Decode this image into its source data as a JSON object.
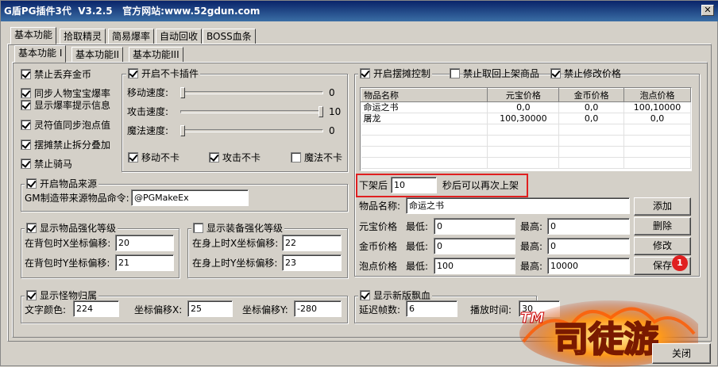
{
  "window": {
    "title": "G盾PG插件3代  V3.2.5   官方网站:www.52gdun.com",
    "close_label": "✕"
  },
  "tabs_top": [
    "基本功能",
    "拾取精灵",
    "简易爆率",
    "自动回收",
    "BOSS血条"
  ],
  "tabs_sub": [
    "基本功能 I",
    "基本功能II",
    "基本功能III"
  ],
  "left_checks": [
    {
      "label": "禁止丢弃金币",
      "checked": true
    },
    {
      "label": "同步人物宝宝爆率",
      "checked": true
    },
    {
      "label": "显示爆率提示信息",
      "checked": true
    },
    {
      "label": "灵符值同步泡点值",
      "checked": true
    },
    {
      "label": "摆摊禁止拆分叠加",
      "checked": true
    },
    {
      "label": "禁止骑马",
      "checked": true
    }
  ],
  "nocard": {
    "title": "开启不卡插件",
    "sliders": [
      {
        "label": "移动速度:",
        "value": "0",
        "level": 0
      },
      {
        "label": "攻击速度:",
        "value": "10",
        "level": 1
      },
      {
        "label": "魔法速度:",
        "value": "0",
        "level": 0
      }
    ],
    "checks": [
      {
        "label": "移动不卡",
        "checked": true
      },
      {
        "label": "攻击不卡",
        "checked": true
      },
      {
        "label": "魔法不卡",
        "checked": false
      }
    ]
  },
  "source": {
    "title": "开启物品来源",
    "label": "GM制造带来源物品命令:",
    "value": "@PGMakeEx"
  },
  "item_enhance": {
    "title": "显示物品强化等级",
    "x_label": "在背包时X坐标偏移:",
    "x_value": "20",
    "y_label": "在背包时Y坐标偏移:",
    "y_value": "21"
  },
  "equip_enhance": {
    "title": "显示装备强化等级",
    "x_label": "在身上时X坐标偏移:",
    "x_value": "22",
    "y_label": "在身上时Y坐标偏移:",
    "y_value": "23"
  },
  "monster": {
    "title": "显示怪物归属",
    "color_label": "文字颜色:",
    "color_value": "224",
    "x_label": "坐标偏移X:",
    "x_value": "25",
    "y_label": "坐标偏移Y:",
    "y_value": "-280"
  },
  "stall": {
    "title": "开启摆摊控制",
    "check2": "禁止取回上架商品",
    "check3": "禁止修改价格",
    "columns": [
      "物品名称",
      "元宝价格",
      "金币价格",
      "泡点价格"
    ],
    "rows": [
      [
        "命运之书",
        "0,0",
        "0,0",
        "100,10000"
      ],
      [
        "屠龙",
        "100,30000",
        "0,0",
        "0,0"
      ]
    ],
    "relist_prefix": "下架后",
    "relist_value": "10",
    "relist_suffix": "秒后可以再次上架",
    "name_label": "物品名称:",
    "name_value": "命运之书",
    "price_rows": [
      {
        "label": "元宝价格",
        "min_label": "最低:",
        "min": "0",
        "max_label": "最高:",
        "max": "0"
      },
      {
        "label": "金币价格",
        "min_label": "最低:",
        "min": "0",
        "max_label": "最高:",
        "max": "0"
      },
      {
        "label": "泡点价格",
        "min_label": "最低:",
        "min": "100",
        "max_label": "最高:",
        "max": "10000"
      }
    ],
    "buttons": {
      "add": "添加",
      "delete": "删除",
      "edit": "修改",
      "save": "保存"
    },
    "badge": "1"
  },
  "float": {
    "title": "显示新版飘血",
    "delay_label": "延迟帧数:",
    "delay_value": "6",
    "play_label": "播放时间:",
    "play_value": "30"
  },
  "close_button": "关闭",
  "logo": {
    "tm": "TM",
    "text": "司徒游"
  },
  "colors": {
    "highlight": "#e02020",
    "face": "#d4d0c8"
  }
}
